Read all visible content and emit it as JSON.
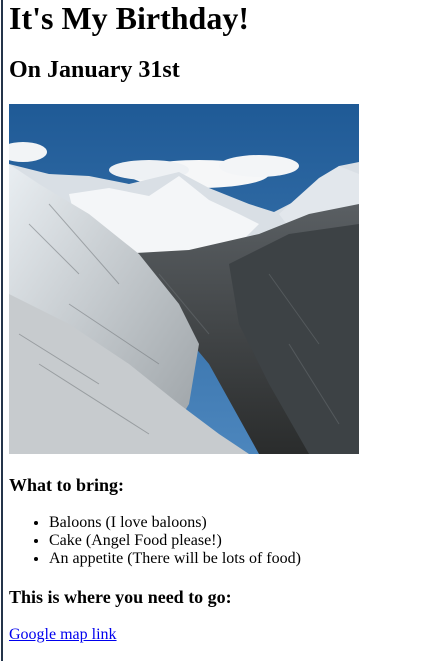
{
  "page": {
    "title": "It's My Birthday!",
    "subtitle": "On January 31st"
  },
  "image": {
    "icon": "mountain-photo",
    "accent_sky": "#2f6aa8"
  },
  "bring": {
    "heading": "What to bring:",
    "items": [
      "Baloons (I love baloons)",
      "Cake (Angel Food please!)",
      "An appetite (There will be lots of food)"
    ]
  },
  "where": {
    "heading": "This is where you need to go:",
    "link_label": "Google map link"
  },
  "colors": {
    "link": "#0000ee",
    "text": "#000000",
    "background": "#ffffff"
  }
}
